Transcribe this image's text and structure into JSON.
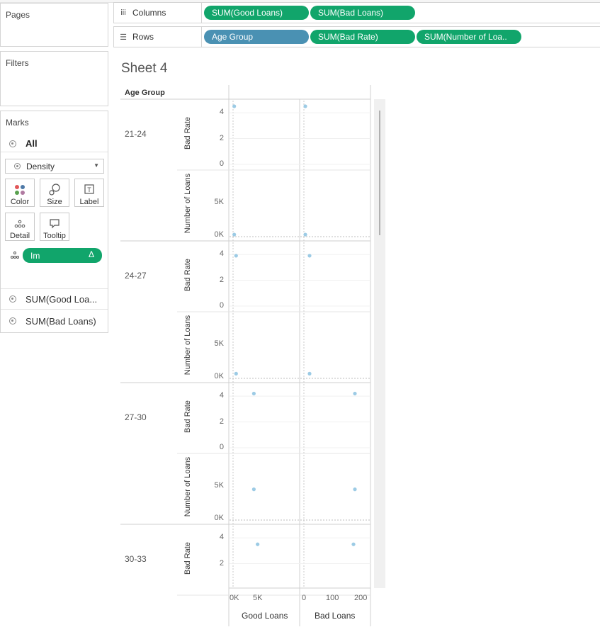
{
  "left_panel": {
    "pages_title": "Pages",
    "filters_title": "Filters",
    "marks_title": "Marks",
    "all_label": "All",
    "mark_type": "Density",
    "buttons": [
      {
        "label": "Color",
        "icon": "color-dots-icon"
      },
      {
        "label": "Size",
        "icon": "size-bubbles-icon"
      },
      {
        "label": "Label",
        "icon": "label-t-icon"
      },
      {
        "label": "Detail",
        "icon": "detail-dots-icon"
      },
      {
        "label": "Tooltip",
        "icon": "tooltip-bubble-icon"
      }
    ],
    "detail_pill": {
      "label": "Im",
      "delta": "Δ"
    },
    "measure_cards": [
      "SUM(Good Loa...",
      "SUM(Bad Loans)"
    ]
  },
  "shelves": {
    "columns_label": "Columns",
    "rows_label": "Rows",
    "columns_pills": [
      "SUM(Good Loans)",
      "SUM(Bad Loans)"
    ],
    "rows_pills": [
      "Age Group",
      "SUM(Bad Rate)",
      "SUM(Number of Loa.."
    ]
  },
  "view": {
    "sheet_title": "Sheet 4",
    "row_header": "Age Group",
    "age_groups": [
      "21-24",
      "24-27",
      "27-30",
      "30-33"
    ],
    "axis_labels": {
      "bad_rate": "Bad Rate",
      "num_loans": "Number of Loans"
    },
    "bad_rate_ticks": [
      "4",
      "2",
      "0"
    ],
    "num_loans_ticks": [
      "5K",
      "0K"
    ],
    "x_ticks_good": [
      "0K",
      "5K"
    ],
    "x_ticks_bad": [
      "0",
      "100",
      "200"
    ],
    "col_labels": [
      "Good Loans",
      "Bad Loans"
    ]
  },
  "chart_data": {
    "type": "scatter",
    "rows": [
      "Age Group",
      "SUM(Bad Rate)",
      "SUM(Number of Loans)"
    ],
    "columns": [
      "SUM(Good Loans)",
      "SUM(Bad Loans)"
    ],
    "xlim_good_loans": [
      0,
      10000
    ],
    "xlim_bad_loans": [
      0,
      220
    ],
    "ylim_bad_rate": [
      0,
      4.5
    ],
    "ylim_number_of_loans": [
      0,
      10000
    ],
    "series": [
      {
        "age_group": "21-24",
        "good_loans": 100,
        "bad_loans": 5,
        "bad_rate": 4.5,
        "number_of_loans": 100
      },
      {
        "age_group": "24-27",
        "good_loans": 500,
        "bad_loans": 20,
        "bad_rate": 3.9,
        "number_of_loans": 500
      },
      {
        "age_group": "27-30",
        "good_loans": 4300,
        "bad_loans": 180,
        "bad_rate": 4.2,
        "number_of_loans": 4500
      },
      {
        "age_group": "30-33",
        "good_loans": 5100,
        "bad_loans": 175,
        "bad_rate": 3.5,
        "number_of_loans": null
      }
    ]
  }
}
